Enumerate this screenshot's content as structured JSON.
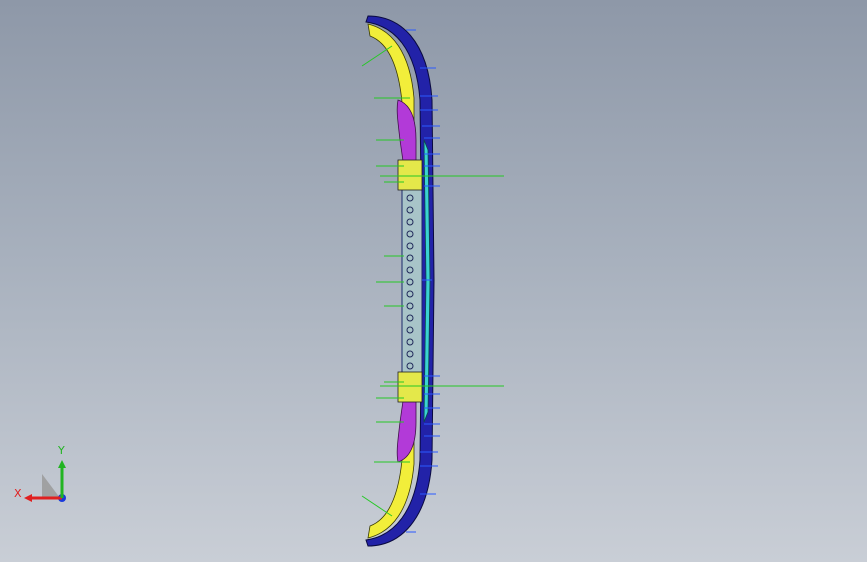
{
  "viewport": {
    "background_top": "#8e98a8",
    "background_bottom": "#c9ced6"
  },
  "triad": {
    "x_label": "X",
    "y_label": "Y",
    "x_color": "#e02020",
    "y_color": "#22b422",
    "z_color": "#1a3adc"
  },
  "colors": {
    "outer_shell": "#2222a8",
    "yellow_part": "#f2ee3a",
    "purple_part": "#b23ad8",
    "cyan_edge": "#3ad2d2",
    "callout_green": "#26c826",
    "callout_blue": "#2a5aff"
  },
  "icons": {
    "view_triad": "xyz-triad-icon"
  }
}
